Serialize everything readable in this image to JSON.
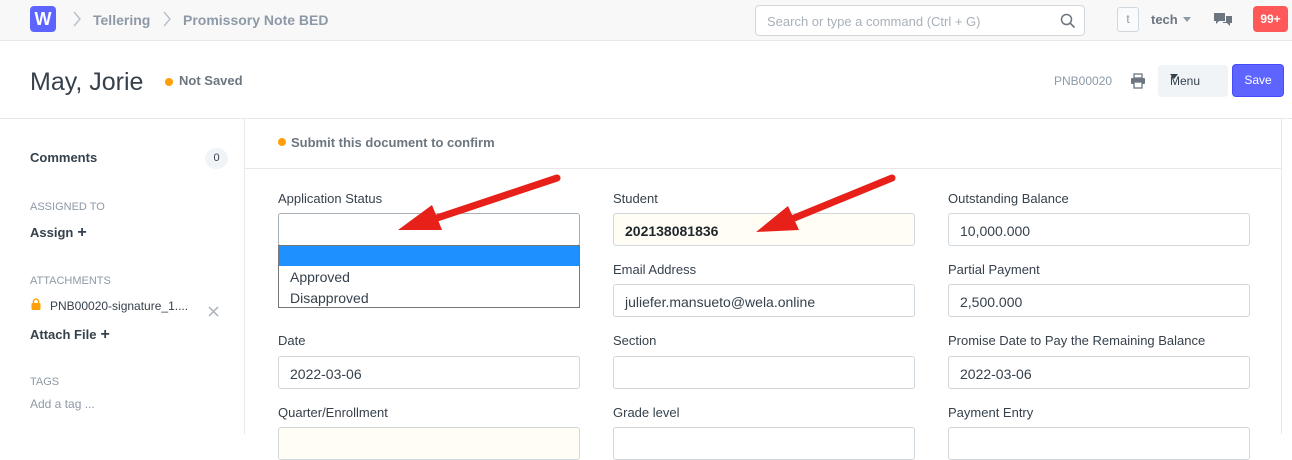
{
  "navbar": {
    "logo": "W",
    "breadcrumbs": [
      "Tellering",
      "Promissory Note BED"
    ],
    "search_placeholder": "Search or type a command (Ctrl + G)",
    "avatar_letter": "t",
    "user": "tech",
    "notifications": "99+"
  },
  "page": {
    "title": "May, Jorie",
    "status": "Not Saved",
    "doc_name": "PNB00020",
    "menu_label": "Menu",
    "save_label": "Save"
  },
  "sidebar": {
    "comments_label": "Comments",
    "comments_count": "0",
    "assigned_heading": "ASSIGNED TO",
    "assign_label": "Assign",
    "attachments_heading": "ATTACHMENTS",
    "attachment_name": "PNB00020-signature_1....",
    "attach_file_label": "Attach File",
    "tags_heading": "TAGS",
    "add_tag": "Add a tag ..."
  },
  "form": {
    "message": "Submit this document to confirm",
    "col1": {
      "application_status_label": "Application Status",
      "application_status_value": "",
      "date_label": "Date",
      "date_value": "2022-03-06",
      "quarter_label": "Quarter/Enrollment"
    },
    "col2": {
      "student_label": "Student",
      "student_value": "202138081836",
      "email_label": "Email Address",
      "email_value": "juliefer.mansueto@wela.online",
      "section_label": "Section",
      "section_value": "",
      "grade_label": "Grade level"
    },
    "col3": {
      "outstanding_label": "Outstanding Balance",
      "outstanding_value": "10,000.000",
      "partial_label": "Partial Payment",
      "partial_value": "2,500.000",
      "promise_label": "Promise Date to Pay the Remaining Balance",
      "promise_value": "2022-03-06",
      "payment_entry_label": "Payment Entry"
    },
    "dropdown_options": [
      "",
      "Approved",
      "Disapproved"
    ]
  },
  "colors": {
    "brand": "#5e64ff",
    "indicator": "#ffa00a",
    "notification": "#ff5858",
    "annotation_arrow": "#e8201a",
    "selected_option": "#1e90ff"
  }
}
